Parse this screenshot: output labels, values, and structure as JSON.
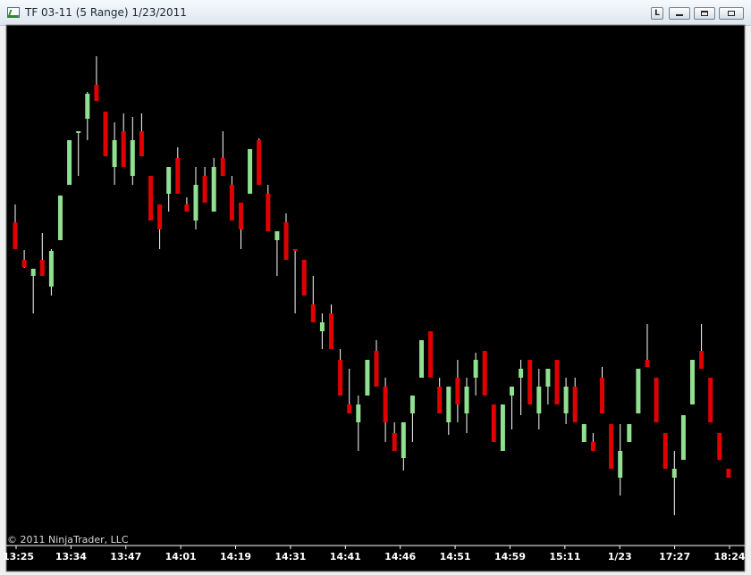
{
  "window": {
    "title": "TF 03-11 (5 Range)  1/23/2011",
    "buttons": {
      "link_label": "L"
    }
  },
  "chart": {
    "copyright": "© 2011 NinjaTrader, LLC",
    "colors": {
      "background": "#000000",
      "up": "#90e090",
      "down": "#e00000",
      "wick": "#ffffff",
      "axis": "#ffffff"
    },
    "x_labels": [
      "13:25",
      "13:34",
      "13:47",
      "14:01",
      "14:19",
      "14:31",
      "14:41",
      "14:46",
      "14:51",
      "14:59",
      "15:11",
      "1/23",
      "17:27",
      "18:24"
    ]
  },
  "chart_data": {
    "type": "candlestick",
    "title": "TF 03-11 (5 Range)  1/23/2011",
    "price_axis_shown": false,
    "candles": [
      {
        "dir": "down",
        "high": 229,
        "open": 249,
        "close": 279,
        "low": 279
      },
      {
        "dir": "down",
        "high": 280,
        "open": 291,
        "close": 299,
        "low": 300
      },
      {
        "dir": "up",
        "high": 301,
        "open": 309,
        "close": 301,
        "low": 351
      },
      {
        "dir": "down",
        "high": 261,
        "open": 291,
        "close": 309,
        "low": 309
      },
      {
        "dir": "up",
        "high": 279,
        "open": 321,
        "close": 281,
        "low": 331
      },
      {
        "dir": "up",
        "high": 219,
        "open": 269,
        "close": 219,
        "low": 269
      },
      {
        "dir": "up",
        "high": 157,
        "open": 207,
        "close": 157,
        "low": 207
      },
      {
        "dir": "up",
        "high": 147,
        "open": 147,
        "close": 147,
        "low": 197
      },
      {
        "dir": "up",
        "high": 103,
        "open": 133,
        "close": 105,
        "low": 157
      },
      {
        "dir": "down",
        "high": 63,
        "open": 95,
        "close": 113,
        "low": 113
      },
      {
        "dir": "down",
        "high": 125,
        "open": 125,
        "close": 175,
        "low": 175
      },
      {
        "dir": "up",
        "high": 137,
        "open": 187,
        "close": 157,
        "low": 207
      },
      {
        "dir": "down",
        "high": 127,
        "open": 147,
        "close": 187,
        "low": 187
      },
      {
        "dir": "up",
        "high": 131,
        "open": 197,
        "close": 157,
        "low": 207
      },
      {
        "dir": "down",
        "high": 127,
        "open": 147,
        "close": 175,
        "low": 175
      },
      {
        "dir": "down",
        "high": 197,
        "open": 197,
        "close": 247,
        "low": 247
      },
      {
        "dir": "down",
        "high": 229,
        "open": 229,
        "close": 257,
        "low": 279
      },
      {
        "dir": "up",
        "high": 187,
        "open": 217,
        "close": 187,
        "low": 237
      },
      {
        "dir": "down",
        "high": 165,
        "open": 177,
        "close": 217,
        "low": 217
      },
      {
        "dir": "down",
        "high": 221,
        "open": 229,
        "close": 237,
        "low": 237
      },
      {
        "dir": "up",
        "high": 187,
        "open": 247,
        "close": 207,
        "low": 257
      },
      {
        "dir": "down",
        "high": 187,
        "open": 197,
        "close": 227,
        "low": 227
      },
      {
        "dir": "up",
        "high": 177,
        "open": 237,
        "close": 187,
        "low": 237
      },
      {
        "dir": "down",
        "high": 147,
        "open": 177,
        "close": 197,
        "low": 197
      },
      {
        "dir": "down",
        "high": 197,
        "open": 207,
        "close": 247,
        "low": 247
      },
      {
        "dir": "down",
        "high": 227,
        "open": 227,
        "close": 257,
        "low": 279
      },
      {
        "dir": "up",
        "high": 167,
        "open": 217,
        "close": 167,
        "low": 217
      },
      {
        "dir": "down",
        "high": 155,
        "open": 157,
        "close": 207,
        "low": 207
      },
      {
        "dir": "down",
        "high": 207,
        "open": 217,
        "close": 259,
        "low": 259
      },
      {
        "dir": "up",
        "high": 259,
        "open": 269,
        "close": 259,
        "low": 309
      },
      {
        "dir": "down",
        "high": 239,
        "open": 249,
        "close": 291,
        "low": 291
      },
      {
        "dir": "down",
        "high": 279,
        "open": 279,
        "close": 281,
        "low": 351
      },
      {
        "dir": "down",
        "high": 291,
        "open": 291,
        "close": 331,
        "low": 331
      },
      {
        "dir": "down",
        "high": 309,
        "open": 341,
        "close": 361,
        "low": 361
      },
      {
        "dir": "up",
        "high": 351,
        "open": 371,
        "close": 361,
        "low": 391
      },
      {
        "dir": "down",
        "high": 341,
        "open": 351,
        "close": 391,
        "low": 391
      },
      {
        "dir": "down",
        "high": 391,
        "open": 403,
        "close": 443,
        "low": 443
      },
      {
        "dir": "down",
        "high": 413,
        "open": 453,
        "close": 463,
        "low": 463
      },
      {
        "dir": "up",
        "high": 443,
        "open": 473,
        "close": 453,
        "low": 505
      },
      {
        "dir": "up",
        "high": 403,
        "open": 443,
        "close": 403,
        "low": 443
      },
      {
        "dir": "down",
        "high": 381,
        "open": 393,
        "close": 433,
        "low": 433
      },
      {
        "dir": "down",
        "high": 423,
        "open": 433,
        "close": 473,
        "low": 495
      },
      {
        "dir": "down",
        "high": 473,
        "open": 485,
        "close": 505,
        "low": 505
      },
      {
        "dir": "up",
        "high": 473,
        "open": 513,
        "close": 473,
        "low": 527
      },
      {
        "dir": "up",
        "high": 443,
        "open": 463,
        "close": 443,
        "low": 495
      },
      {
        "dir": "up",
        "high": 381,
        "open": 423,
        "close": 381,
        "low": 423
      },
      {
        "dir": "down",
        "high": 371,
        "open": 371,
        "close": 423,
        "low": 423
      },
      {
        "dir": "down",
        "high": 423,
        "open": 433,
        "close": 463,
        "low": 463
      },
      {
        "dir": "up",
        "high": 433,
        "open": 473,
        "close": 433,
        "low": 487
      },
      {
        "dir": "down",
        "high": 403,
        "open": 423,
        "close": 453,
        "low": 473
      },
      {
        "dir": "up",
        "high": 423,
        "open": 463,
        "close": 433,
        "low": 485
      },
      {
        "dir": "up",
        "high": 395,
        "open": 423,
        "close": 403,
        "low": 443
      },
      {
        "dir": "down",
        "high": 393,
        "open": 393,
        "close": 443,
        "low": 443
      },
      {
        "dir": "down",
        "high": 453,
        "open": 453,
        "close": 495,
        "low": 495
      },
      {
        "dir": "up",
        "high": 453,
        "open": 505,
        "close": 453,
        "low": 505
      },
      {
        "dir": "up",
        "high": 433,
        "open": 443,
        "close": 433,
        "low": 481
      },
      {
        "dir": "up",
        "high": 403,
        "open": 423,
        "close": 413,
        "low": 465
      },
      {
        "dir": "down",
        "high": 403,
        "open": 403,
        "close": 453,
        "low": 453
      },
      {
        "dir": "up",
        "high": 413,
        "open": 463,
        "close": 433,
        "low": 481
      },
      {
        "dir": "up",
        "high": 413,
        "open": 433,
        "close": 413,
        "low": 453
      },
      {
        "dir": "down",
        "high": 403,
        "open": 403,
        "close": 453,
        "low": 453
      },
      {
        "dir": "up",
        "high": 423,
        "open": 463,
        "close": 433,
        "low": 475
      },
      {
        "dir": "down",
        "high": 423,
        "open": 433,
        "close": 473,
        "low": 473
      },
      {
        "dir": "up",
        "high": 475,
        "open": 495,
        "close": 475,
        "low": 485
      },
      {
        "dir": "down",
        "high": 485,
        "open": 495,
        "close": 505,
        "low": 505
      },
      {
        "dir": "down",
        "high": 411,
        "open": 423,
        "close": 463,
        "low": 463
      },
      {
        "dir": "down",
        "high": 475,
        "open": 475,
        "close": 525,
        "low": 525
      },
      {
        "dir": "up",
        "high": 475,
        "open": 535,
        "close": 505,
        "low": 555
      },
      {
        "dir": "up",
        "high": 475,
        "open": 495,
        "close": 475,
        "low": 495
      },
      {
        "dir": "up",
        "high": 413,
        "open": 463,
        "close": 413,
        "low": 463
      },
      {
        "dir": "down",
        "high": 363,
        "open": 403,
        "close": 411,
        "low": 411
      },
      {
        "dir": "down",
        "high": 423,
        "open": 423,
        "close": 473,
        "low": 473
      },
      {
        "dir": "down",
        "high": 485,
        "open": 485,
        "close": 525,
        "low": 525
      },
      {
        "dir": "up",
        "high": 505,
        "open": 535,
        "close": 525,
        "low": 577
      },
      {
        "dir": "up",
        "high": 465,
        "open": 515,
        "close": 465,
        "low": 515
      },
      {
        "dir": "up",
        "high": 403,
        "open": 453,
        "close": 403,
        "low": 453
      },
      {
        "dir": "down",
        "high": 363,
        "open": 393,
        "close": 413,
        "low": 413
      },
      {
        "dir": "down",
        "high": 423,
        "open": 423,
        "close": 473,
        "low": 473
      },
      {
        "dir": "down",
        "high": 485,
        "open": 485,
        "close": 515,
        "low": 515
      },
      {
        "dir": "down",
        "high": 525,
        "open": 525,
        "close": 535,
        "low": 535
      }
    ]
  }
}
